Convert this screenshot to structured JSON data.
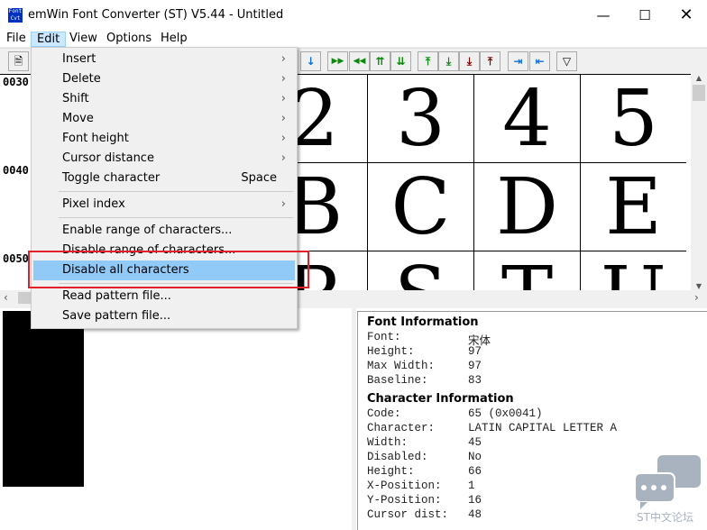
{
  "window": {
    "title": "emWin Font Converter (ST) V5.44 - Untitled",
    "icon_text": "Font Cvt",
    "controls": [
      "minimize",
      "maximize",
      "close"
    ]
  },
  "menubar": [
    "File",
    "Edit",
    "View",
    "Options",
    "Help"
  ],
  "toolbar": {
    "icons": [
      "new-file-icon",
      "arrow-down-icon",
      "next-fast-icon",
      "prev-fast-icon",
      "first-up-icon",
      "last-down-icon",
      "insert-top-icon",
      "insert-bottom-icon",
      "remove-top-icon",
      "remove-bottom-icon",
      "cursor-right-icon",
      "cursor-left-icon",
      "filter-icon"
    ]
  },
  "grid": {
    "row_labels": [
      "0030",
      "0040",
      "0050"
    ],
    "rows": [
      [
        "2",
        "3",
        "4",
        "5"
      ],
      [
        "B",
        "C",
        "D",
        "E"
      ],
      [
        "R",
        "S",
        "T",
        "U"
      ]
    ]
  },
  "edit_menu": {
    "items": [
      {
        "label": "Insert",
        "submenu": true
      },
      {
        "label": "Delete",
        "submenu": true
      },
      {
        "label": "Shift",
        "submenu": true
      },
      {
        "label": "Move",
        "submenu": true
      },
      {
        "label": "Font height",
        "submenu": true
      },
      {
        "label": "Cursor distance",
        "submenu": true
      },
      {
        "label": "Toggle character",
        "shortcut": "Space"
      },
      {
        "label": "Pixel index",
        "submenu": true
      },
      {
        "label": "Enable range of characters..."
      },
      {
        "label": "Disable range of characters..."
      },
      {
        "label": "Disable all characters",
        "highlighted": true
      },
      {
        "label": "Read pattern file..."
      },
      {
        "label": "Save pattern file..."
      }
    ]
  },
  "font_info": {
    "heading": "Font Information",
    "rows": [
      [
        "Font:",
        "宋体"
      ],
      [
        "Height:",
        "97"
      ],
      [
        "Max Width:",
        "97"
      ],
      [
        "Baseline:",
        "83"
      ]
    ]
  },
  "char_info": {
    "heading": "Character Information",
    "rows": [
      [
        "Code:",
        "65 (0x0041)"
      ],
      [
        "Character:",
        "LATIN CAPITAL LETTER A"
      ],
      [
        "Width:",
        "45"
      ],
      [
        "Disabled:",
        "No"
      ],
      [
        "Height:",
        "66"
      ],
      [
        "X-Position:",
        "1"
      ],
      [
        "Y-Position:",
        "16"
      ],
      [
        "Cursor dist:",
        "48"
      ]
    ]
  },
  "watermark": "ST中文论坛",
  "colors": {
    "highlight": "#91c9f7",
    "annotation": "#e32028",
    "menu_active": "#cce8ff"
  }
}
